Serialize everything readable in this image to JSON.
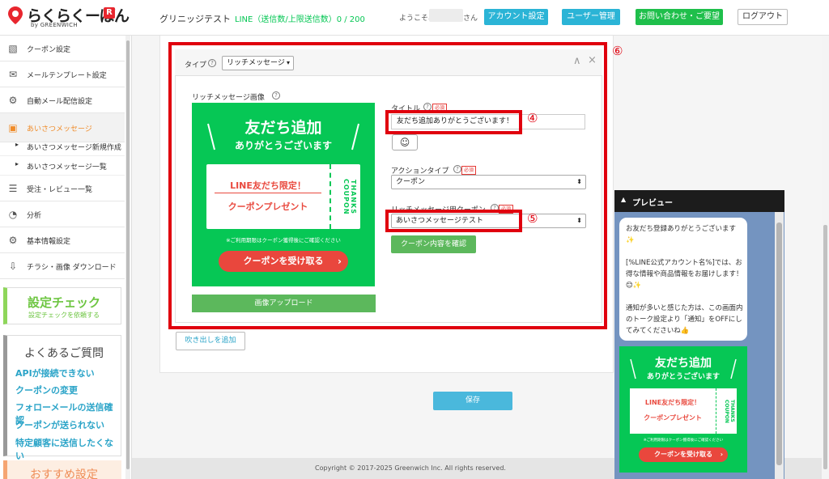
{
  "header": {
    "logo_text": "らくらくーぽん",
    "logo_badge": "R",
    "logo_by": "by GREENWICH",
    "store_name": "グリニッジテスト",
    "line_status": "LINE（送信数/上限送信数）0 / 200",
    "welcome": "ようこそ、",
    "welcome_suffix": "さん",
    "account_button": "アカウント設定",
    "user_button": "ユーザー管理",
    "contact_button": "お問い合わせ・ご要望",
    "logout_button": "ログアウト"
  },
  "sidebar": {
    "items": [
      {
        "label": "クーポン設定",
        "icon": "percent-icon"
      },
      {
        "label": "メールテンプレート設定",
        "icon": "mail-icon"
      },
      {
        "label": "自動メール配信設定",
        "icon": "gears-icon"
      },
      {
        "label": "あいさつメッセージ",
        "icon": "greeting-icon"
      }
    ],
    "subitems": [
      {
        "label": "あいさつメッセージ新規作成"
      },
      {
        "label": "あいさつメッセージ一覧"
      }
    ],
    "items2": [
      {
        "label": "受注・レビュー一覧",
        "icon": "list-icon"
      },
      {
        "label": "分析",
        "icon": "pie-chart-icon"
      },
      {
        "label": "基本情報設定",
        "icon": "gear-icon"
      },
      {
        "label": "チラシ・画像 ダウンロード",
        "icon": "download-icon"
      }
    ],
    "check_title": "設定チェック",
    "check_sub": "設定チェックを依頼する",
    "faq_title": "よくあるご質問",
    "faq_links": [
      "APIが接続できない",
      "クーポンの変更",
      "フォローメールの送信確認",
      "クーポンが送られない",
      "特定顧客に送信したくない"
    ],
    "recommend_title": "おすすめ設定"
  },
  "editor": {
    "type_label": "タイプ",
    "type_value": "リッチメッセージ",
    "image_label": "リッチメッセージ画像",
    "title_label": "タイトル",
    "required": "必須",
    "title_value": "友だち追加ありがとうございます！",
    "action_type_label": "アクションタイプ",
    "action_type_value": "クーポン",
    "coupon_label": "リッチメッセージ用クーポン",
    "coupon_value": "あいさつメッセージテスト",
    "coupon_button": "クーポン内容を確認",
    "upload_button": "画像アップロード",
    "add_bubble_button": "吹き出しを追加",
    "save_button": "保存",
    "marker_4": "④",
    "marker_5": "⑤",
    "marker_6": "⑥"
  },
  "rich_image": {
    "headline": "友だち追加",
    "subline": "ありがとうございます",
    "ticket_title": "LINE友だち限定！",
    "ticket_sub": "クーポンプレゼント",
    "stub_text": "THANKS COUPON",
    "notice": "※ご利用期限はクーポン獲得後にご確認ください",
    "cta": "クーポンを受け取る"
  },
  "preview": {
    "title": "プレビュー",
    "message": "お友だち登録ありがとうございます✨\n\n[%LINE公式アカウント名%]では、お得な情報や商品情報をお届けします！😊✨\n\n通知が多いと感じた方は、この画面内のトーク設定より「通知」をOFFにしてみてくださいね👍"
  },
  "footer": {
    "copyright": "Copyright © 2017-2025 Greenwich Inc. All rights reserved."
  },
  "colors": {
    "line_green": "#06c755",
    "highlight_red": "#e0000e",
    "teal": "#2bb4d6",
    "button_green": "#5cb85c"
  }
}
